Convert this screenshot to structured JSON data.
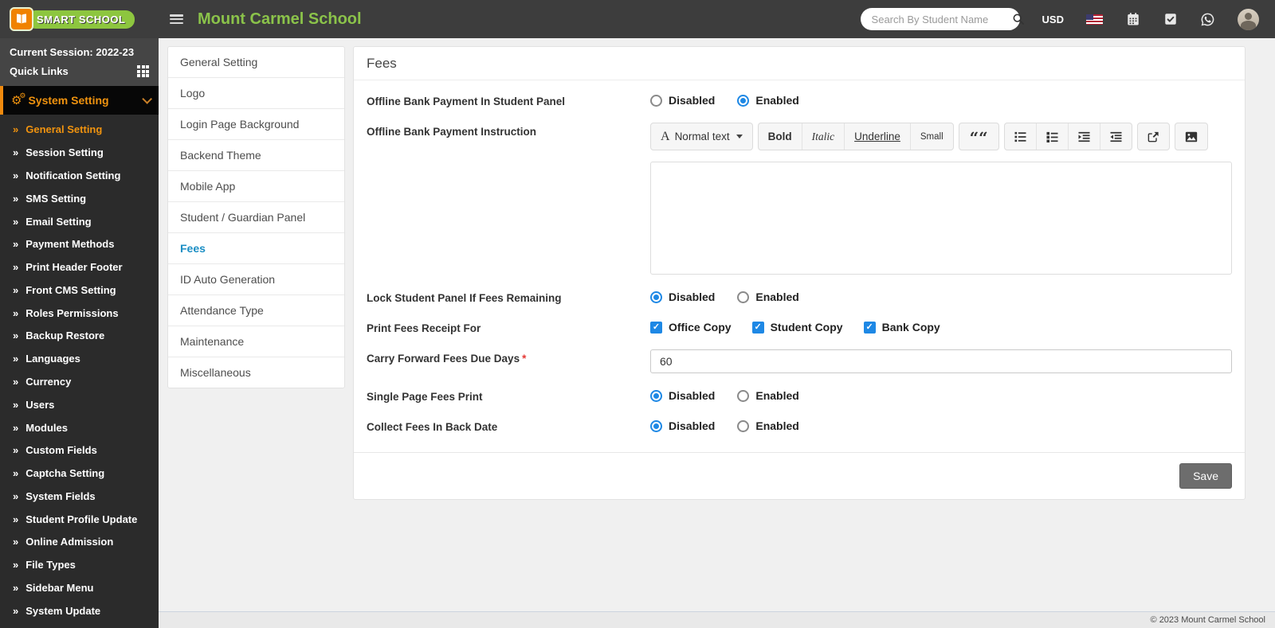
{
  "colors": {
    "header_bg": "#3d3d3d",
    "sidebar_bg": "#2b2b2b",
    "accent_orange": "#f0930f",
    "brand_green": "#8dc63f",
    "title_green": "#8bc34a",
    "link_blue": "#1b8ec4",
    "control_blue": "#1e88e5",
    "save_gray": "#6d6d6d"
  },
  "header": {
    "brand": "SMART SCHOOL",
    "school_name": "Mount Carmel School",
    "search_placeholder": "Search By Student Name",
    "currency": "USD"
  },
  "sidebar": {
    "session": "Current Session: 2022-23",
    "quick_links": "Quick Links",
    "section": "System Setting",
    "active_item": "General Setting",
    "items": [
      "General Setting",
      "Session Setting",
      "Notification Setting",
      "SMS Setting",
      "Email Setting",
      "Payment Methods",
      "Print Header Footer",
      "Front CMS Setting",
      "Roles Permissions",
      "Backup Restore",
      "Languages",
      "Currency",
      "Users",
      "Modules",
      "Custom Fields",
      "Captcha Setting",
      "System Fields",
      "Student Profile Update",
      "Online Admission",
      "File Types",
      "Sidebar Menu",
      "System Update"
    ]
  },
  "submenu": {
    "active": "Fees",
    "items": [
      "General Setting",
      "Logo",
      "Login Page Background",
      "Backend Theme",
      "Mobile App",
      "Student / Guardian Panel",
      "Fees",
      "ID Auto Generation",
      "Attendance Type",
      "Maintenance",
      "Miscellaneous"
    ]
  },
  "page": {
    "title": "Fees"
  },
  "form": {
    "offline_bank_payment": {
      "label": "Offline Bank Payment In Student Panel",
      "disabled": "Disabled",
      "enabled": "Enabled",
      "selected": "Enabled"
    },
    "instruction": {
      "label": "Offline Bank Payment Instruction",
      "editor_value": ""
    },
    "editor_toolbar": {
      "style_icon": "A",
      "style": "Normal text",
      "bold": "Bold",
      "italic": "Italic",
      "underline": "Underline",
      "small": "Small",
      "quote": "““"
    },
    "lock_student_panel": {
      "label": "Lock Student Panel If Fees Remaining",
      "disabled": "Disabled",
      "enabled": "Enabled",
      "selected": "Disabled"
    },
    "print_receipt": {
      "label": "Print Fees Receipt For",
      "options": [
        "Office Copy",
        "Student Copy",
        "Bank Copy"
      ],
      "checked": [
        true,
        true,
        true
      ]
    },
    "carry_forward": {
      "label": "Carry Forward Fees Due Days",
      "required_mark": "*",
      "value": "60"
    },
    "single_page": {
      "label": "Single Page Fees Print",
      "disabled": "Disabled",
      "enabled": "Enabled",
      "selected": "Disabled"
    },
    "collect_back_date": {
      "label": "Collect Fees In Back Date",
      "disabled": "Disabled",
      "enabled": "Enabled",
      "selected": "Disabled"
    },
    "save_label": "Save"
  },
  "footer": {
    "copyright": "© 2023 Mount Carmel School"
  }
}
